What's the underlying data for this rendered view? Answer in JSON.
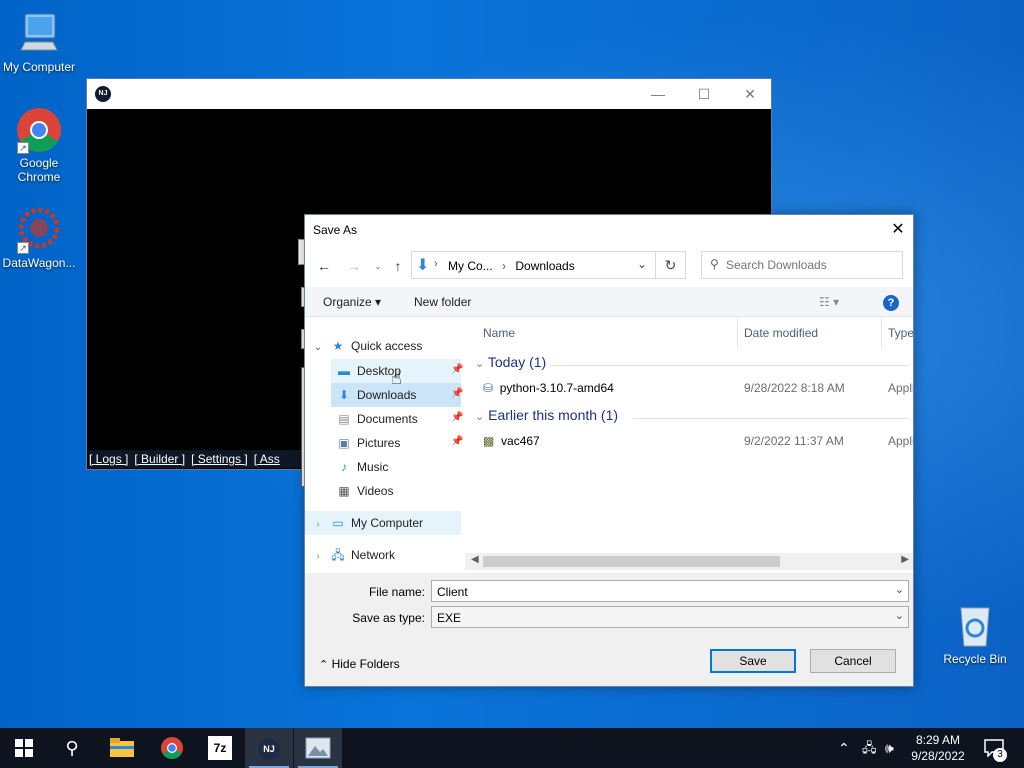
{
  "desktop": {
    "icons": [
      {
        "label": "My Computer"
      },
      {
        "label": "Google Chrome"
      },
      {
        "label": "DataWagon..."
      },
      {
        "label": "Recycle Bin"
      }
    ]
  },
  "app_window": {
    "logo_text": "NJ",
    "links": [
      "[ Logs ]",
      "[ Builder ]",
      "[ Settings ]",
      "[ Ass"
    ]
  },
  "dialog": {
    "title": "Save As",
    "address": {
      "crumbs": [
        "My Co...",
        "Downloads"
      ]
    },
    "search": {
      "placeholder": "Search Downloads"
    },
    "toolbar": {
      "organize": "Organize",
      "new_folder": "New folder",
      "help": "?"
    },
    "nav": {
      "quick_access": "Quick access",
      "items": [
        "Desktop",
        "Downloads",
        "Documents",
        "Pictures",
        "Music",
        "Videos"
      ],
      "my_computer": "My Computer",
      "network": "Network"
    },
    "columns": {
      "name": "Name",
      "date": "Date modified",
      "type": "Type"
    },
    "groups": [
      {
        "label": "Today (1)",
        "files": [
          {
            "name": "python-3.10.7-amd64",
            "date": "9/28/2022 8:18 AM",
            "type": "Appli"
          }
        ]
      },
      {
        "label": "Earlier this month (1)",
        "files": [
          {
            "name": "vac467",
            "date": "9/2/2022 11:37 AM",
            "type": "Appli"
          }
        ]
      }
    ],
    "file_name_label": "File name:",
    "file_name_value": "Client",
    "save_type_label": "Save as type:",
    "save_type_value": "EXE",
    "hide_folders": "Hide Folders",
    "save_button": "Save",
    "cancel_button": "Cancel"
  },
  "taskbar": {
    "apps": [
      "start-icon",
      "search-icon",
      "file-explorer-icon",
      "chrome-icon",
      "7zip-icon",
      "nj-rat-icon",
      "image-viewer-icon"
    ],
    "sevenzip_label": "7z",
    "nj_label": "NJ",
    "time": "8:29 AM",
    "date": "9/28/2022",
    "notifications": "3"
  }
}
